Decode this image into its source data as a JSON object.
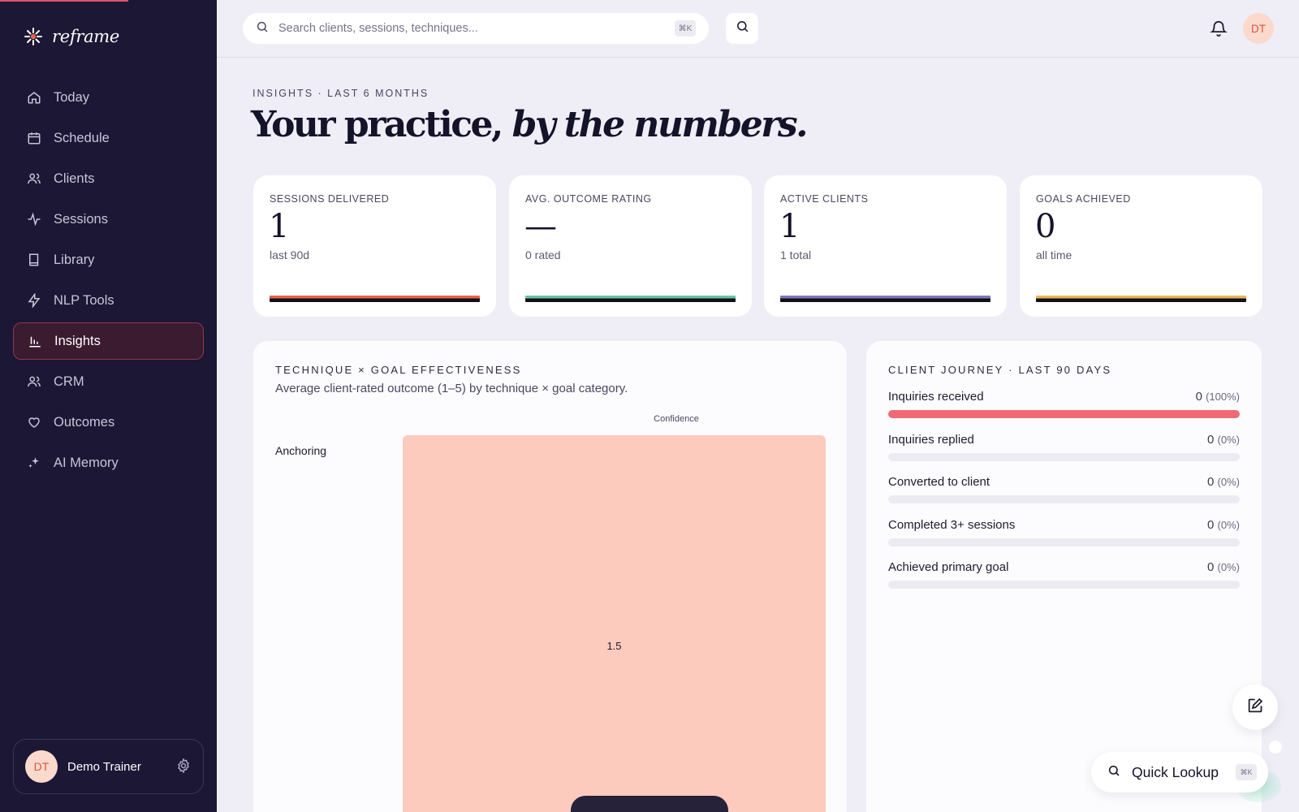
{
  "brand": {
    "name": "reframe"
  },
  "sidebar": {
    "items": [
      {
        "label": "Today",
        "icon": "home-icon"
      },
      {
        "label": "Schedule",
        "icon": "calendar-icon"
      },
      {
        "label": "Clients",
        "icon": "users-icon"
      },
      {
        "label": "Sessions",
        "icon": "activity-icon"
      },
      {
        "label": "Library",
        "icon": "book-icon"
      },
      {
        "label": "NLP Tools",
        "icon": "bolt-icon"
      },
      {
        "label": "Insights",
        "icon": "bar-chart-icon",
        "active": true
      },
      {
        "label": "CRM",
        "icon": "users-icon"
      },
      {
        "label": "Outcomes",
        "icon": "heart-icon"
      },
      {
        "label": "AI Memory",
        "icon": "sparkles-icon"
      }
    ],
    "user": {
      "initials": "DT",
      "name": "Demo Trainer"
    }
  },
  "topbar": {
    "search_placeholder": "Search clients, sessions, techniques...",
    "search_shortcut": "⌘K",
    "avatar_initials": "DT"
  },
  "header": {
    "eyebrow": "INSIGHTS · LAST 6 MONTHS",
    "title_plain": "Your practice, ",
    "title_italic": "by the numbers."
  },
  "kpis": [
    {
      "label": "SESSIONS DELIVERED",
      "value": "1",
      "sub": "last 90d",
      "color": "#e8634a"
    },
    {
      "label": "AVG. OUTCOME RATING",
      "value": "—",
      "sub": "0 rated",
      "color": "#6cc3a4"
    },
    {
      "label": "ACTIVE CLIENTS",
      "value": "1",
      "sub": "1 total",
      "color": "#7c79b8"
    },
    {
      "label": "GOALS ACHIEVED",
      "value": "0",
      "sub": "all time",
      "color": "#e9b65a"
    }
  ],
  "technique_panel": {
    "title": "TECHNIQUE × GOAL EFFECTIVENESS",
    "subtitle": "Average client-rated outcome (1–5) by technique × goal category.",
    "column": "Confidence",
    "row": "Anchoring",
    "cell_value": "1.5",
    "cell_color": "#fdcbbd"
  },
  "journey": {
    "title": "CLIENT JOURNEY · LAST 90 DAYS",
    "stages": [
      {
        "label": "Inquiries received",
        "value": "0",
        "pct": "(100%)",
        "fraction": 1.0
      },
      {
        "label": "Inquiries replied",
        "value": "0",
        "pct": "(0%)",
        "fraction": 0
      },
      {
        "label": "Converted to client",
        "value": "0",
        "pct": "(0%)",
        "fraction": 0
      },
      {
        "label": "Completed 3+ sessions",
        "value": "0",
        "pct": "(0%)",
        "fraction": 0
      },
      {
        "label": "Achieved primary goal",
        "value": "0",
        "pct": "(0%)",
        "fraction": 0
      }
    ]
  },
  "floating": {
    "quick_lookup": "Quick Lookup",
    "quick_shortcut": "⌘K",
    "edit_icon": "edit-icon"
  }
}
